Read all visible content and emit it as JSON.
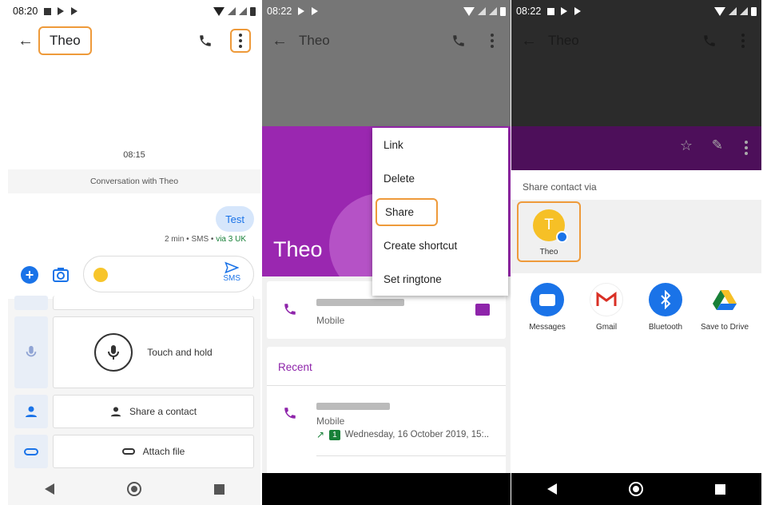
{
  "colors": {
    "accent": "#1a73e8",
    "highlight": "#ee9a3a",
    "contact_purple": "#9a27b0",
    "chat_bubble": "#d6e6fb",
    "via_green": "#188038"
  },
  "panel1": {
    "status_time": "08:20",
    "contact_name": "Theo",
    "timestamp": "08:15",
    "conversation_label": "Conversation with Theo",
    "message_text": "Test",
    "message_meta": "2 min • SMS • ",
    "message_via": "via 3 UK",
    "send_label": "SMS",
    "voice_label": "Touch and hold",
    "share_contact_label": "Share a contact",
    "attach_file_label": "Attach file"
  },
  "panel2": {
    "status_time": "08:22",
    "contact_name": "Theo",
    "header_name": "Theo",
    "phone_type": "Mobile",
    "recent_label": "Recent",
    "recent_phone_type": "Mobile",
    "recent_sim": "1",
    "recent_date": "Wednesday, 16 October 2019, 15:..",
    "menu": [
      "Link",
      "Delete",
      "Share",
      "Create shortcut",
      "Set ringtone"
    ]
  },
  "panel3": {
    "status_time": "08:22",
    "contact_name": "Theo",
    "share_title": "Share contact via",
    "contact_initial": "T",
    "contact_label": "Theo",
    "apps": [
      {
        "label": "Messages",
        "icon": "messages-icon"
      },
      {
        "label": "Gmail",
        "icon": "gmail-icon"
      },
      {
        "label": "Bluetooth",
        "icon": "bluetooth-icon"
      },
      {
        "label": "Save to Drive",
        "icon": "drive-icon"
      }
    ]
  }
}
